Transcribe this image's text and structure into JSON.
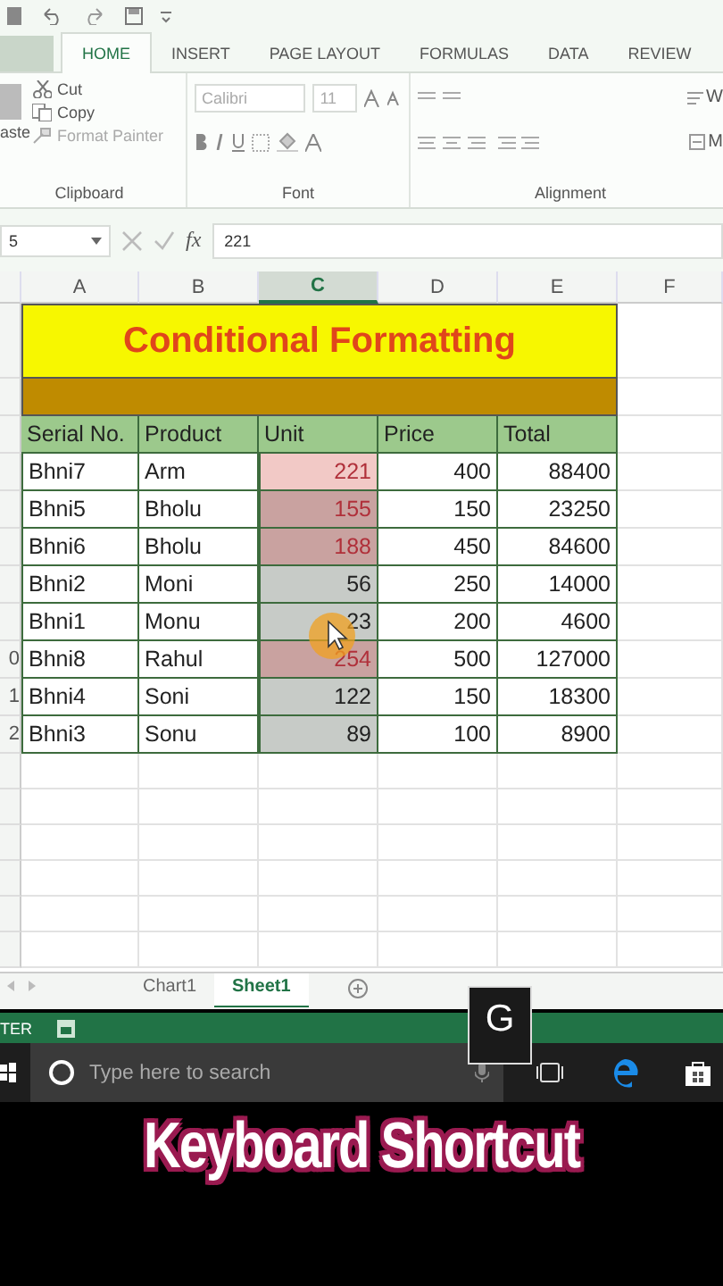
{
  "ribbon": {
    "tabs": [
      {
        "label": "HOME",
        "selected": true
      },
      {
        "label": "INSERT",
        "selected": false
      },
      {
        "label": "PAGE LAYOUT",
        "selected": false
      },
      {
        "label": "FORMULAS",
        "selected": false
      },
      {
        "label": "DATA",
        "selected": false
      },
      {
        "label": "REVIEW",
        "selected": false
      }
    ],
    "clipboard": {
      "paste_label": "aste",
      "cut": "Cut",
      "copy": "Copy",
      "format_painter": "Format Painter",
      "label": "Clipboard"
    },
    "font": {
      "name": "Calibri",
      "size": "11",
      "label": "Font"
    },
    "alignment": {
      "label": "Alignment",
      "wrap": "W",
      "merge": "M"
    }
  },
  "formula_bar": {
    "name_box": "5",
    "function_label": "fx",
    "value": "221"
  },
  "sheet": {
    "columns": [
      {
        "label": "A",
        "selected": false
      },
      {
        "label": "B",
        "selected": false
      },
      {
        "label": "C",
        "selected": true
      },
      {
        "label": "D",
        "selected": false
      },
      {
        "label": "E",
        "selected": false
      },
      {
        "label": "F",
        "selected": false
      }
    ],
    "title": "Conditional Formatting",
    "header": [
      "Serial No.",
      "Product",
      "Unit",
      "Price",
      "Total"
    ],
    "rows": [
      {
        "serial": "Bhni7",
        "product": "Arm",
        "unit": "221",
        "color": "#f2c9c6",
        "highlighted": true,
        "price": "400",
        "total": "88400"
      },
      {
        "serial": "Bhni5",
        "product": "Bholu",
        "unit": "155",
        "color": "#c9a2a0",
        "highlighted": true,
        "price": "150",
        "total": "23250"
      },
      {
        "serial": "Bhni6",
        "product": "Bholu",
        "unit": "188",
        "color": "#c9a2a0",
        "highlighted": true,
        "price": "450",
        "total": "84600"
      },
      {
        "serial": "Bhni2",
        "product": "Moni",
        "unit": "56",
        "color": "#c7cbc7",
        "highlighted": false,
        "price": "250",
        "total": "14000"
      },
      {
        "serial": "Bhni1",
        "product": "Monu",
        "unit": "23",
        "color": "#c7cbc7",
        "highlighted": false,
        "price": "200",
        "total": "4600"
      },
      {
        "serial": "Bhni8",
        "row_number": "0",
        "product": "Rahul",
        "unit": "254",
        "color": "#c9a2a0",
        "highlighted": true,
        "price": "500",
        "total": "127000"
      },
      {
        "serial": "Bhni4",
        "row_number": "1",
        "product": "Soni",
        "unit": "122",
        "color": "#c7cbc7",
        "highlighted": false,
        "price": "150",
        "total": "18300"
      },
      {
        "serial": "Bhni3",
        "row_number": "2",
        "product": "Sonu",
        "unit": "89",
        "color": "#c7cbc7",
        "highlighted": false,
        "price": "100",
        "total": "8900"
      }
    ],
    "sheet_tabs": [
      {
        "label": "Chart1",
        "selected": false
      },
      {
        "label": "Sheet1",
        "selected": true
      }
    ]
  },
  "status_bar": {
    "mode": "TER"
  },
  "key_overlay": "G",
  "taskbar": {
    "search": {
      "placeholder": "Type here to search"
    }
  },
  "caption": "Keyboard Shortcut"
}
